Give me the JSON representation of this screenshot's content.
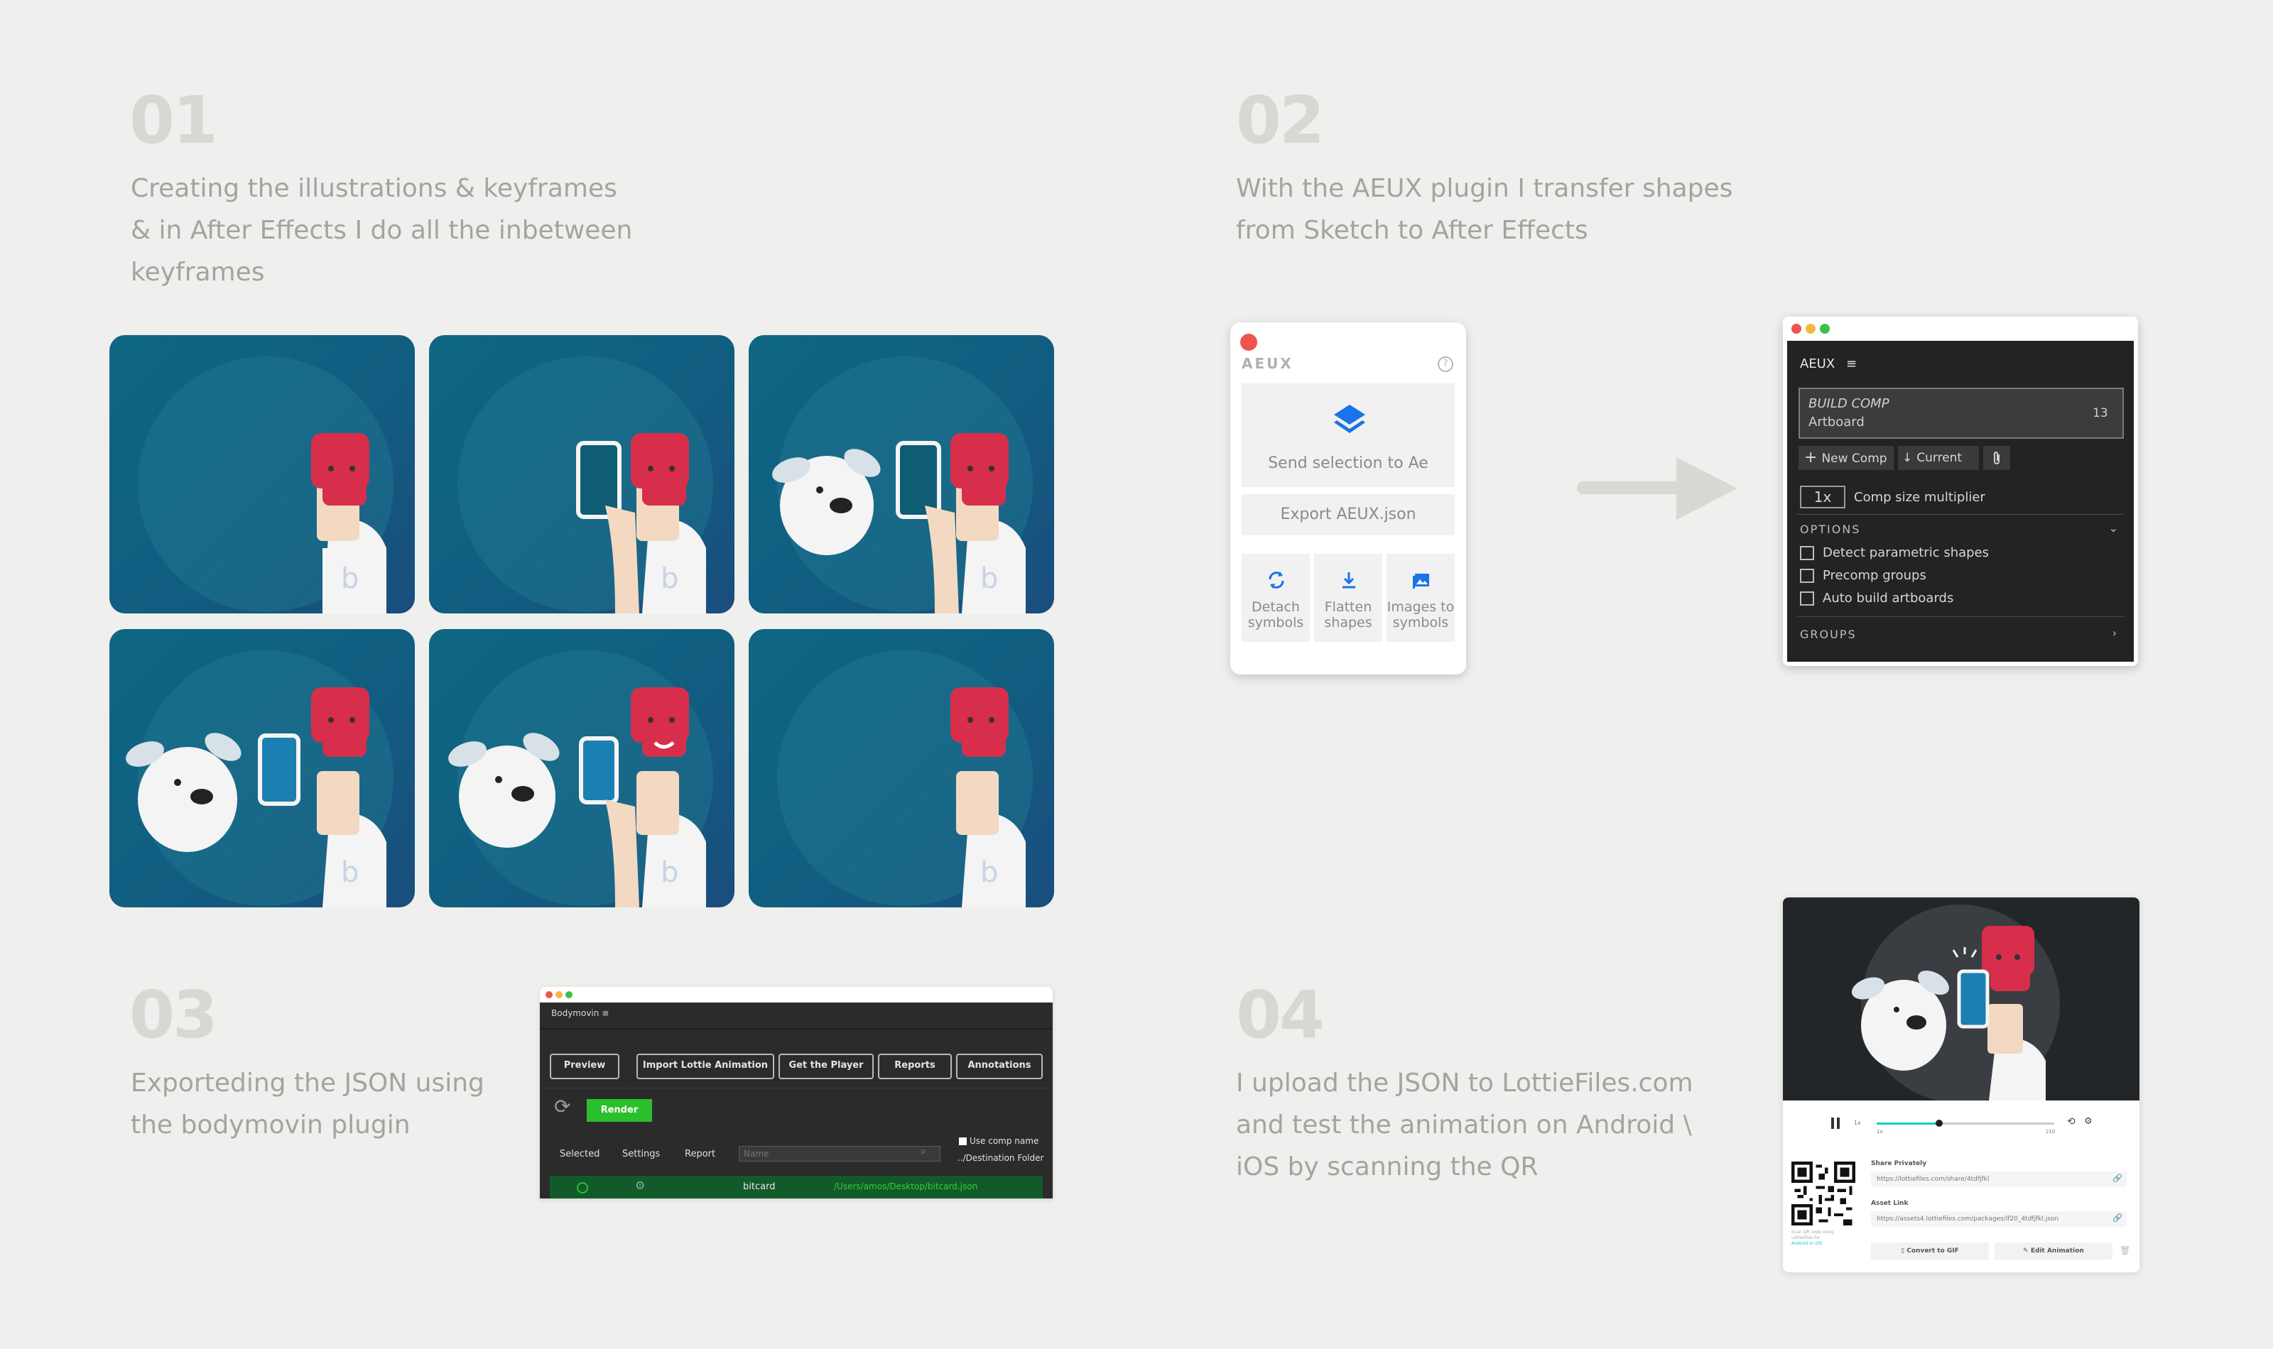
{
  "steps": [
    {
      "number": "01",
      "lines": [
        "Creating the illustrations & keyframes",
        "& in After Effects I do all the inbetween",
        "keyframes"
      ]
    },
    {
      "number": "02",
      "lines": [
        "With the AEUX plugin I transfer shapes",
        "from Sketch to After Effects"
      ]
    },
    {
      "number": "03",
      "lines": [
        "Exporteding the JSON using",
        "the bodymovin plugin"
      ]
    },
    {
      "number": "04",
      "lines": [
        "I upload the JSON to LottieFiles.com",
        "and test the animation on Android \\",
        "iOS by scanning the QR"
      ]
    }
  ],
  "aeux_light": {
    "title": "AEUX",
    "help": "?",
    "send": "Send selection to Ae",
    "export": "Export AEUX.json",
    "tools": [
      {
        "icon": "refresh-icon",
        "line1": "Detach",
        "line2": "symbols"
      },
      {
        "icon": "download-icon",
        "line1": "Flatten",
        "line2": "shapes"
      },
      {
        "icon": "image-icon",
        "line1": "Images to",
        "line2": "symbols"
      }
    ]
  },
  "aeux_dark": {
    "title": "AEUX",
    "build_comp": "BUILD COMP",
    "artboard": "Artboard",
    "count": "13",
    "new_comp": "New Comp",
    "current": "Current",
    "multiplier_value": "1x",
    "multiplier_label": "Comp size multiplier",
    "options_label": "OPTIONS",
    "options": [
      "Detect parametric shapes",
      "Precomp groups",
      "Auto build artboards"
    ],
    "groups_label": "GROUPS"
  },
  "bodymovin": {
    "title": "Bodymovin",
    "buttons": [
      "Preview",
      "Import Lottie Animation",
      "Get the Player",
      "Reports",
      "Annotations"
    ],
    "render": "Render",
    "col_selected": "Selected",
    "col_settings": "Settings",
    "col_report": "Report",
    "name_placeholder": "Name",
    "use_comp_name": "Use comp name",
    "destination": "../Destination Folder",
    "row_name": "bitcard",
    "row_path": "/Users/amos/Desktop/bitcard.json"
  },
  "lottie": {
    "share_label": "Share Privately",
    "share_url": "https://lottiefiles.com/share/4tdfjfkl",
    "asset_label": "Asset Link",
    "asset_url": "https://assets4.lottiefiles.com/packages/lf20_4tdfjfkl.json",
    "convert": "Convert to GIF",
    "edit": "Edit Animation",
    "speed": "1x",
    "frame_start": "1x",
    "frame_end": "210",
    "scan_note": "Scan QR code using",
    "scan_app": "LottieFiles for",
    "platforms": "Android or iOS",
    "progress": 0.35
  },
  "colors": {
    "teal": "#0f6784",
    "red": "#d72e4b",
    "green": "#2bc02b",
    "lottie_green": "#0fccce",
    "arrow": "#d8d8d5"
  }
}
